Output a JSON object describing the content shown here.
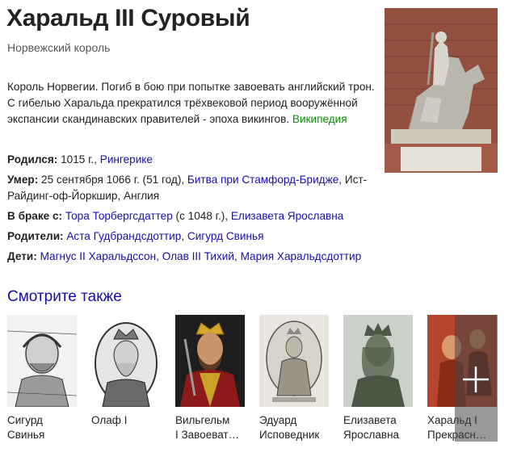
{
  "header": {
    "title": "Харальд III Суровый",
    "subtitle": "Норвежский король"
  },
  "description": {
    "text": "Король Норвегии. Погиб в бою при попытке завоевать английский трон. С гибелью Харальда прекратился трёхвековой период вооружённой экспансии скандинавских правителей - эпоха викингов.",
    "source_link": "Википедия"
  },
  "facts": {
    "born": {
      "label": "Родился:",
      "text": " 1015 г., ",
      "link": "Рингерике"
    },
    "died": {
      "label": "Умер:",
      "text": " 25 сентября 1066 г. (51 год), ",
      "link": "Битва при Стамфорд-Бридже",
      "text2": ", Ист-Райдинг-оф-Йоркшир, Англия"
    },
    "spouse": {
      "label": "В браке с:",
      "link1": "Тора Торбергсдаттер",
      "text": " (с 1048 г.), ",
      "link2": "Елизавета Ярославна"
    },
    "parents": {
      "label": "Родители:",
      "link1": "Аста Гудбрандсдоттир",
      "sep": ", ",
      "link2": "Сигурд Свинья"
    },
    "children": {
      "label": "Дети:",
      "link1": "Магнус II Харальдссон",
      "sep1": ", ",
      "link2": "Олав III Тихий",
      "sep2": ", ",
      "link3": "Мария Харальдсдоттир"
    }
  },
  "see_also": {
    "title": "Смотрите также",
    "items": [
      {
        "line1": "Сигурд",
        "line2": "Свинья"
      },
      {
        "line1": "Олаф I",
        "line2": ""
      },
      {
        "line1": "Вильгельм",
        "line2": "I Завоеват…"
      },
      {
        "line1": "Эдуард",
        "line2": "Исповедник"
      },
      {
        "line1": "Елизавета",
        "line2": "Ярославна"
      },
      {
        "line1": "Харальд I",
        "line2": "Прекрасн…"
      }
    ]
  },
  "icons": {
    "more": "plus-icon"
  }
}
